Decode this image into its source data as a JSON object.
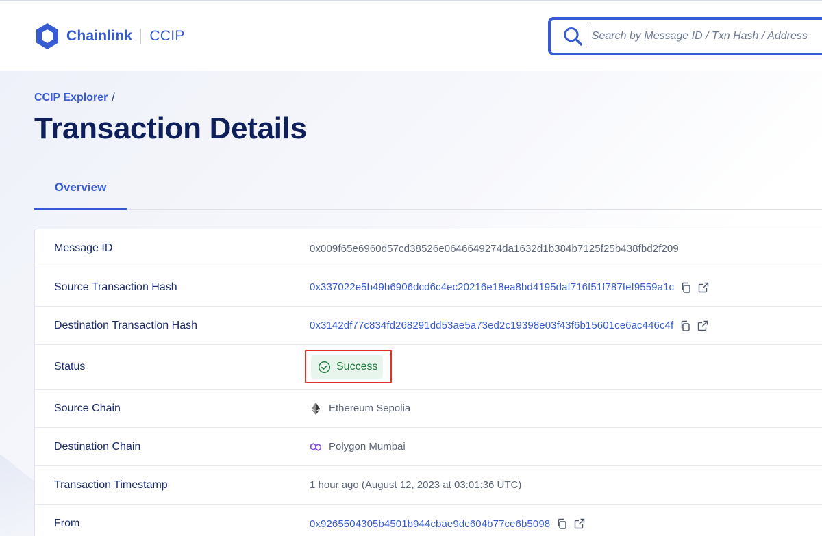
{
  "header": {
    "brand": "Chainlink",
    "product": "CCIP",
    "search_placeholder": "Search by Message ID / Txn Hash / Address"
  },
  "breadcrumb": {
    "root": "CCIP Explorer",
    "separator": "/"
  },
  "page_title": "Transaction Details",
  "tabs": [
    {
      "label": "Overview",
      "active": true
    }
  ],
  "details": {
    "message_id": {
      "label": "Message ID",
      "value": "0x009f65e6960d57cd38526e0646649274da1632d1b384b7125f25b438fbd2f209"
    },
    "source_tx": {
      "label": "Source Transaction Hash",
      "value": "0x337022e5b49b6906dcd6c4ec20216e18ea8bd4195daf716f51f787fef9559a1c"
    },
    "dest_tx": {
      "label": "Destination Transaction Hash",
      "value": "0x3142df77c834fd268291dd53ae5a73ed2c19398e03f43f6b15601ce6ac446c4f"
    },
    "status": {
      "label": "Status",
      "value": "Success"
    },
    "source_chain": {
      "label": "Source Chain",
      "value": "Ethereum Sepolia",
      "icon": "ethereum-icon"
    },
    "dest_chain": {
      "label": "Destination Chain",
      "value": "Polygon Mumbai",
      "icon": "polygon-icon"
    },
    "timestamp": {
      "label": "Transaction Timestamp",
      "value": "1 hour ago (August 12, 2023 at 03:01:36 UTC)"
    },
    "from": {
      "label": "From",
      "value": "0x9265504305b4501b944cbae9dc604b77ce6b5098"
    }
  },
  "colors": {
    "accent": "#375bd2",
    "title": "#0f1f5a",
    "success_bg": "#e8f5ec",
    "success_text": "#1f7a3e",
    "highlight_box": "#e0312b"
  }
}
